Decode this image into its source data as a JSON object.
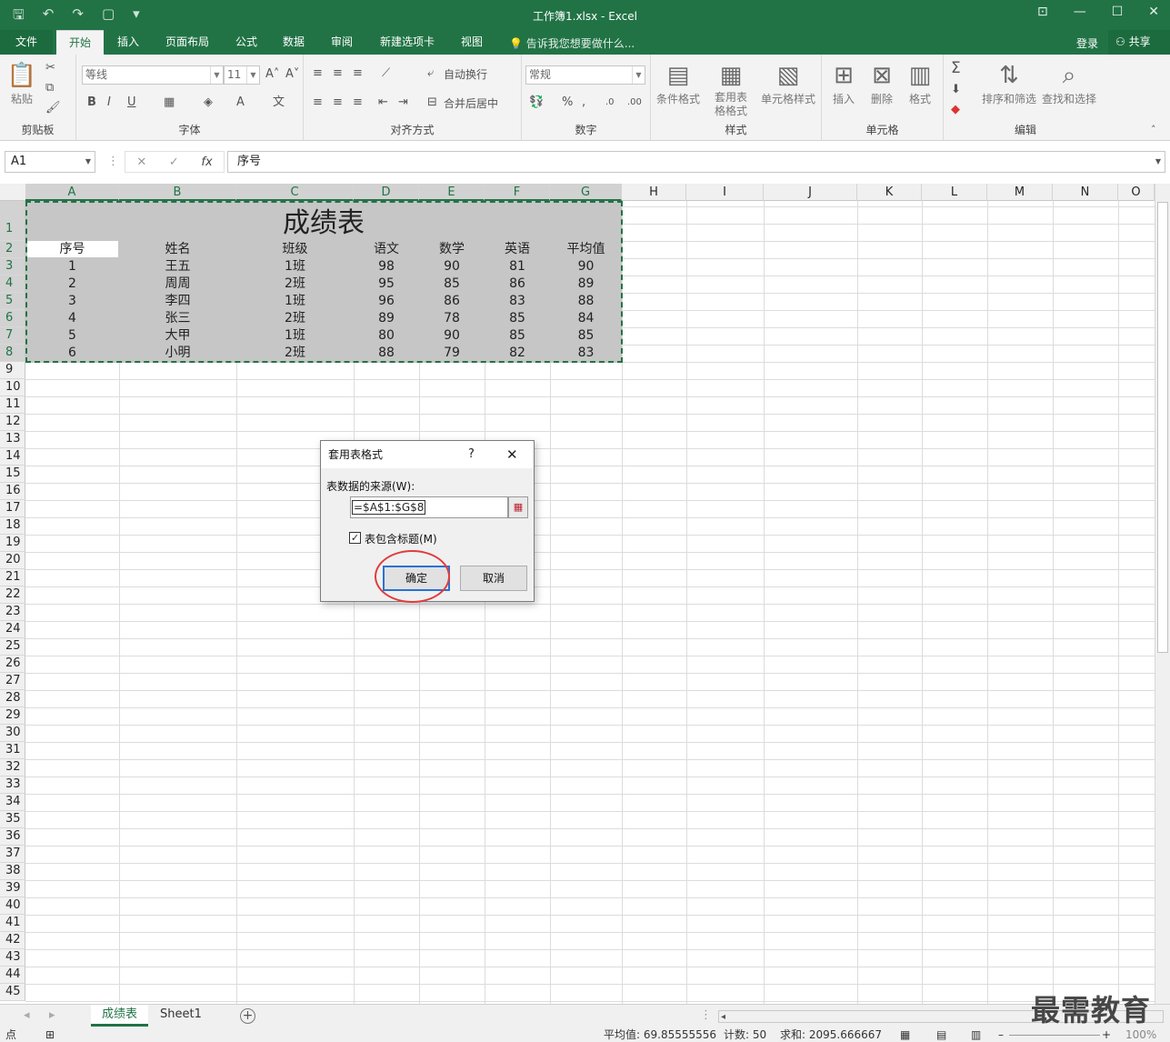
{
  "window": {
    "title": "工作簿1.xlsx - Excel",
    "login": "登录",
    "share": "共享"
  },
  "ribbon": {
    "tabs": [
      "文件",
      "开始",
      "插入",
      "页面布局",
      "公式",
      "数据",
      "审阅",
      "新建选项卡",
      "视图"
    ],
    "active_tab": "开始",
    "tell_me": "告诉我您想要做什么...",
    "groups": {
      "clipboard": "剪贴板",
      "font": "字体",
      "align": "对齐方式",
      "number": "数字",
      "styles": "样式",
      "cells": "单元格",
      "editing": "编辑"
    },
    "paste": "粘贴",
    "font_name": "等线",
    "font_size": "11",
    "wrap_text": "自动换行",
    "merge_center": "合并后居中",
    "number_format": "常规",
    "cond_format": "条件格式",
    "table_format": "套用表格格式",
    "cell_styles": "单元格样式",
    "insert": "插入",
    "delete": "删除",
    "format": "格式",
    "sort_filter": "排序和筛选",
    "find_select": "查找和选择"
  },
  "formula_bar": {
    "name_box": "A1",
    "content": "序号"
  },
  "columns": [
    "A",
    "B",
    "C",
    "D",
    "E",
    "F",
    "G",
    "H",
    "I",
    "J",
    "K",
    "L",
    "M",
    "N",
    "O"
  ],
  "rows": [
    "1",
    "2",
    "3",
    "4",
    "5",
    "6",
    "7",
    "8",
    "9",
    "10",
    "11",
    "12",
    "13",
    "14",
    "15",
    "16",
    "17",
    "18",
    "19",
    "20",
    "21",
    "22",
    "23",
    "24",
    "25",
    "26",
    "27",
    "28",
    "29",
    "30",
    "31",
    "32",
    "33",
    "34",
    "35",
    "36",
    "37",
    "38",
    "39",
    "40",
    "41",
    "42",
    "43",
    "44",
    "45"
  ],
  "sheet": {
    "title": "成绩表",
    "headers": [
      "序号",
      "姓名",
      "班级",
      "语文",
      "数学",
      "英语",
      "平均值"
    ],
    "data": [
      [
        "1",
        "王五",
        "1班",
        "98",
        "90",
        "81",
        "90"
      ],
      [
        "2",
        "周周",
        "2班",
        "95",
        "85",
        "86",
        "89"
      ],
      [
        "3",
        "李四",
        "1班",
        "96",
        "86",
        "83",
        "88"
      ],
      [
        "4",
        "张三",
        "2班",
        "89",
        "78",
        "85",
        "84"
      ],
      [
        "5",
        "大甲",
        "1班",
        "80",
        "90",
        "85",
        "85"
      ],
      [
        "6",
        "小明",
        "2班",
        "88",
        "79",
        "82",
        "83"
      ]
    ]
  },
  "dialog": {
    "title": "套用表格式",
    "help": "?",
    "source_label": "表数据的来源(W):",
    "range": "=$A$1:$G$8",
    "has_headers": "表包含标题(M)",
    "ok": "确定",
    "cancel": "取消"
  },
  "sheet_tabs": [
    "成绩表",
    "Sheet1"
  ],
  "status": {
    "mode": "点",
    "average": "平均值: 69.85555556",
    "count": "计数: 50",
    "sum": "求和: 2095.666667",
    "zoom": "100%"
  },
  "watermark": "最需教育",
  "colors": {
    "accent": "#217346",
    "selection": "#c6c6c6",
    "annotation": "#e03c3c"
  }
}
